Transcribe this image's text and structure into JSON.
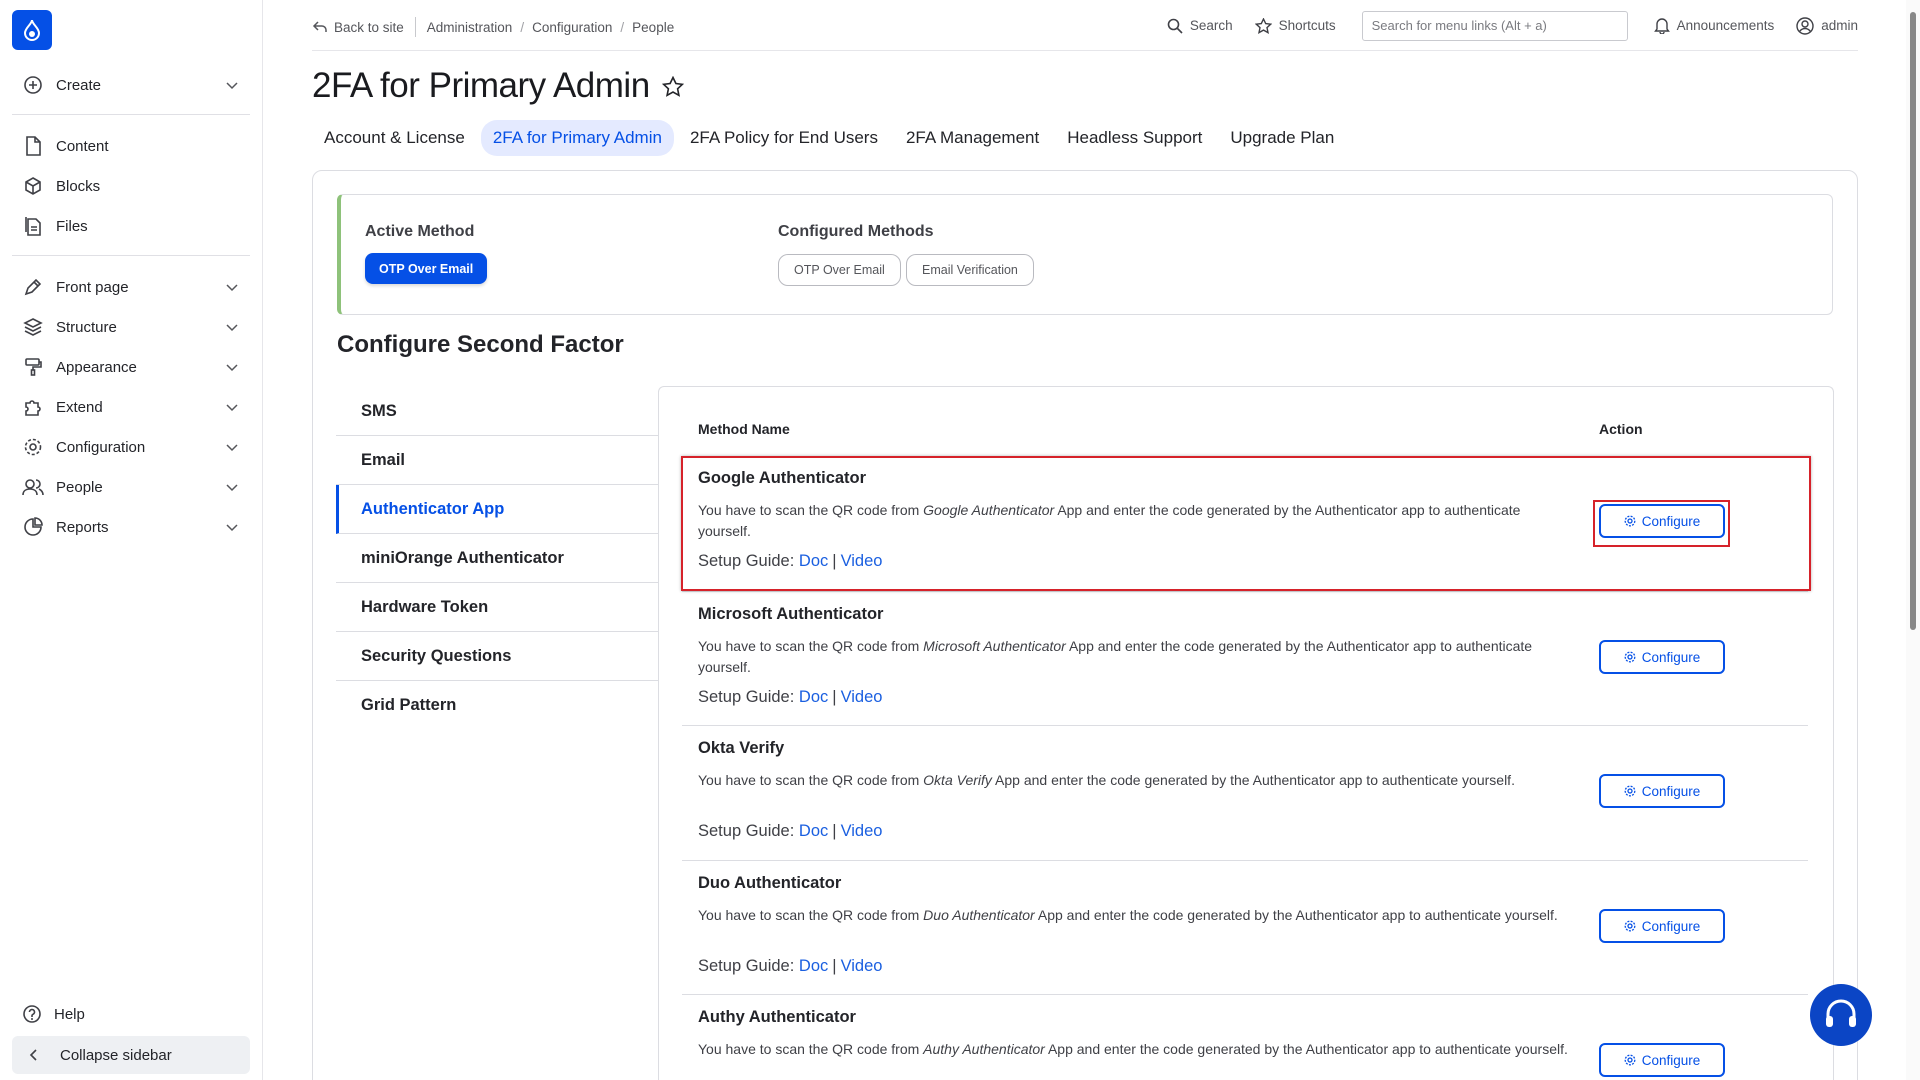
{
  "sidebar": {
    "create": "Create",
    "content": "Content",
    "blocks": "Blocks",
    "files": "Files",
    "front_page": "Front page",
    "structure": "Structure",
    "appearance": "Appearance",
    "extend": "Extend",
    "configuration": "Configuration",
    "people": "People",
    "reports": "Reports",
    "help": "Help",
    "collapse": "Collapse sidebar"
  },
  "topbar": {
    "back": "Back to site",
    "crumb1": "Administration",
    "crumb2": "Configuration",
    "crumb3": "People",
    "search": "Search",
    "shortcuts": "Shortcuts",
    "menu_search_placeholder": "Search for menu links (Alt + a)",
    "announcements": "Announcements",
    "user": "admin"
  },
  "page": {
    "title": "2FA for Primary Admin"
  },
  "tabs": [
    "Account & License",
    "2FA for Primary Admin",
    "2FA Policy for End Users",
    "2FA Management",
    "Headless Support",
    "Upgrade Plan"
  ],
  "methods_box": {
    "active_label": "Active Method",
    "active_value": "OTP Over Email",
    "configured_label": "Configured Methods",
    "configured": [
      "OTP Over Email",
      "Email Verification"
    ]
  },
  "section": {
    "title": "Configure Second Factor"
  },
  "method_list": [
    "SMS",
    "Email",
    "Authenticator App",
    "miniOrange Authenticator",
    "Hardware Token",
    "Security Questions",
    "Grid Pattern"
  ],
  "table": {
    "col_method": "Method Name",
    "col_action": "Action",
    "configure": "Configure",
    "setup_guide": "Setup Guide:",
    "doc": "Doc",
    "video": "Video",
    "desc_prefix": "You have to scan the QR code from",
    "rows": [
      {
        "name": "Google Authenticator",
        "app": "Google Authenticator",
        "rest": "App and enter the code generated by the Authenticator app to authenticate yourself."
      },
      {
        "name": "Microsoft Authenticator",
        "app": "Microsoft Authenticator",
        "rest": "App and enter the code generated by the Authenticator app to authenticate yourself."
      },
      {
        "name": "Okta Verify",
        "app": "Okta Verify",
        "rest": "App and enter the code generated by the Authenticator app to authenticate yourself."
      },
      {
        "name": "Duo Authenticator",
        "app": "Duo Authenticator",
        "rest": "App and enter the code generated by the Authenticator app to authenticate yourself."
      },
      {
        "name": "Authy Authenticator",
        "app": "Authy Authenticator",
        "rest": "App and enter the code generated by the Authenticator app to authenticate yourself."
      }
    ]
  },
  "colors": {
    "accent": "#0550e6",
    "highlight": "#d6222a",
    "active_border": "#8ec27a"
  }
}
